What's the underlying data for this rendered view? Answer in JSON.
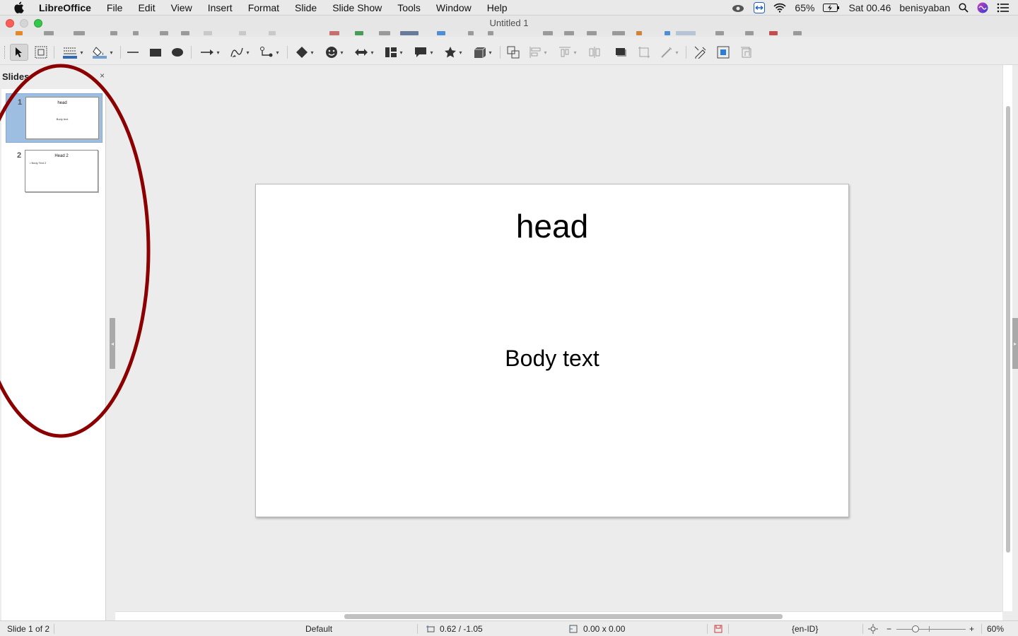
{
  "menubar": {
    "app_name": "LibreOffice",
    "items": [
      "File",
      "Edit",
      "View",
      "Insert",
      "Format",
      "Slide",
      "Slide Show",
      "Tools",
      "Window",
      "Help"
    ],
    "battery": "65%",
    "clock": "Sat 00.46",
    "user": "benisyaban"
  },
  "window": {
    "title": "Untitled 1"
  },
  "toolbar": {
    "items": [
      {
        "name": "select-tool",
        "icon": "arrow-pointer-icon"
      },
      {
        "name": "zoom-pan-tool",
        "icon": "zoom-pan-icon"
      },
      {
        "name": "line-color",
        "icon": "line-color-icon",
        "color": "#2e6ab7"
      },
      {
        "name": "fill-color",
        "icon": "fill-color-icon",
        "color": "#729fcf"
      },
      {
        "name": "insert-line",
        "icon": "line-icon"
      },
      {
        "name": "insert-rectangle",
        "icon": "rectangle-icon"
      },
      {
        "name": "insert-ellipse",
        "icon": "ellipse-icon"
      },
      {
        "name": "lines-and-arrows",
        "icon": "arrow-line-icon"
      },
      {
        "name": "curves-polygons",
        "icon": "curve-icon"
      },
      {
        "name": "connectors",
        "icon": "connector-icon"
      },
      {
        "name": "basic-shapes",
        "icon": "diamond-icon"
      },
      {
        "name": "symbol-shapes",
        "icon": "smiley-icon"
      },
      {
        "name": "block-arrows",
        "icon": "double-arrow-icon"
      },
      {
        "name": "flowchart",
        "icon": "flowchart-icon"
      },
      {
        "name": "callouts",
        "icon": "callout-icon"
      },
      {
        "name": "stars",
        "icon": "star-icon"
      },
      {
        "name": "3d-objects",
        "icon": "cube-icon"
      }
    ]
  },
  "slides_pane": {
    "header": "Slides",
    "close_glyph": "×",
    "slides": [
      {
        "number": "1",
        "title": "head",
        "body": "Body text"
      },
      {
        "number": "2",
        "title": "Head 2",
        "body": "• Body Text 2"
      }
    ]
  },
  "slide": {
    "title": "head",
    "body": "Body text"
  },
  "statusbar": {
    "slide_info": "Slide 1 of 2",
    "master": "Default",
    "position": "0.62 / -1.05",
    "size": "0.00 x 0.00",
    "language": "{en-ID}",
    "zoom_minus": "−",
    "zoom_plus": "+",
    "zoom": "60%"
  },
  "annotation_color": "#8b0000"
}
